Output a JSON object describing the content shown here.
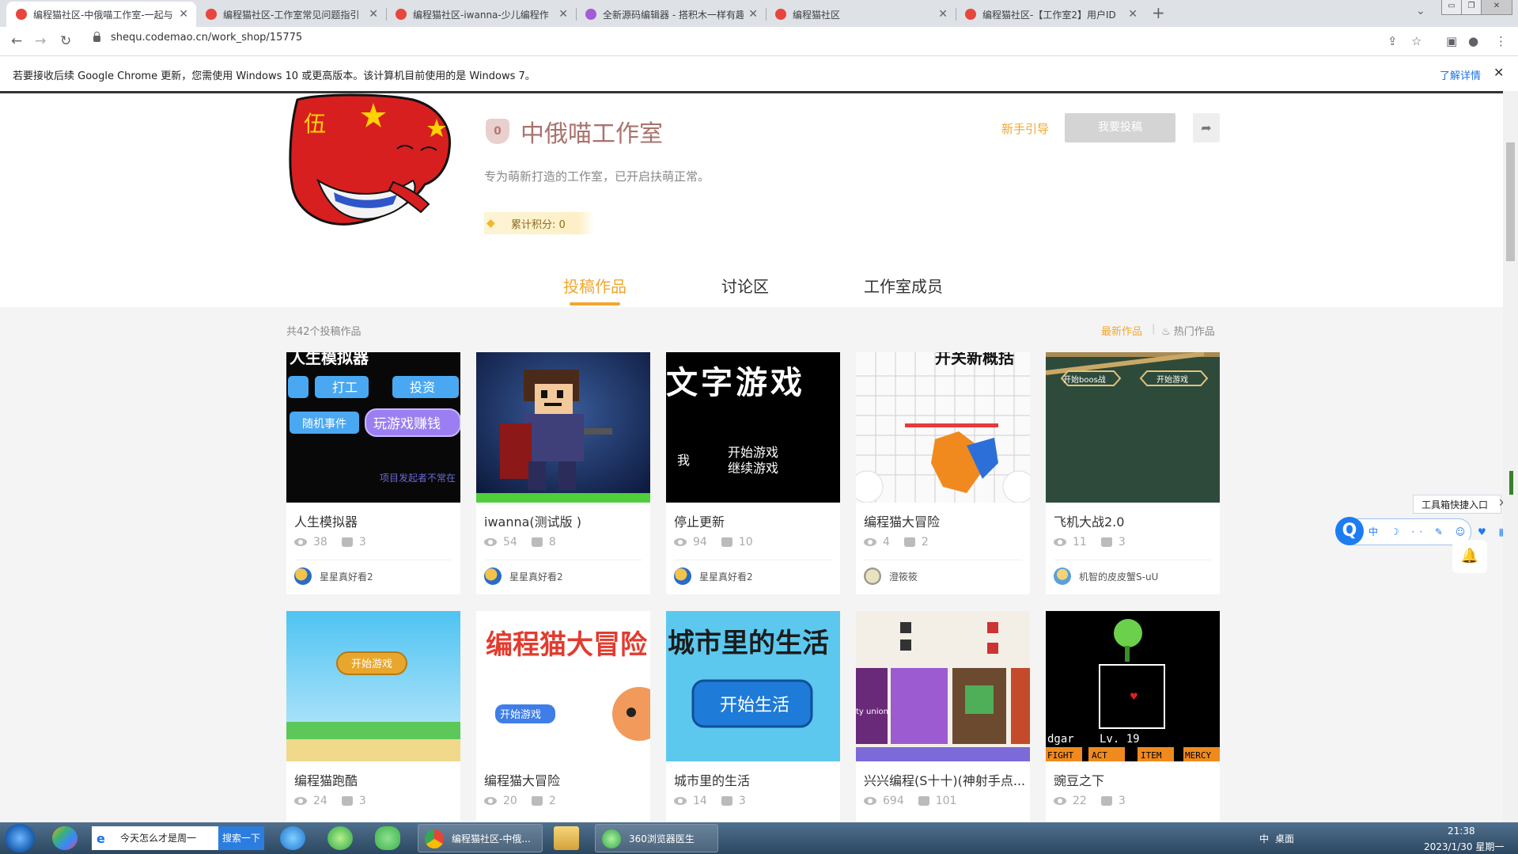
{
  "browser": {
    "tabs": [
      {
        "label": "编程猫社区-中俄喵工作室-一起与"
      },
      {
        "label": "编程猫社区-工作室常见问题指引"
      },
      {
        "label": "编程猫社区-iwanna-少儿编程作"
      },
      {
        "label": "全新源码编辑器 - 搭积木一样有趣"
      },
      {
        "label": "编程猫社区"
      },
      {
        "label": "编程猫社区-【工作室2】用户ID"
      }
    ],
    "url": "shequ.codemao.cn/work_shop/15775",
    "infobar": {
      "text": "若要接收后续 Google Chrome 更新，您需使用 Windows 10 或更高版本。该计算机目前使用的是 Windows 7。",
      "link": "了解详情"
    }
  },
  "studio": {
    "badge": "0",
    "title": "中俄喵工作室",
    "guide_link": "新手引导",
    "submit_button": "我要投稿",
    "description": "专为萌新打造的工作室，已开启扶萌正常。",
    "points": "累计积分: 0",
    "tabs": [
      "投稿作品",
      "讨论区",
      "工作室成员"
    ],
    "work_count": "共42个投稿作品",
    "sort": {
      "newest": "最新作品",
      "separator": "|",
      "hot": "热门作品"
    }
  },
  "works": [
    {
      "name": "人生模拟器",
      "views": "38",
      "likes": "3",
      "author": "星星真好看2",
      "thumb_text": [
        "人生模拟器",
        "打工",
        "投资",
        "随机事件",
        "玩游戏赚钱",
        "项目发起者不常在"
      ]
    },
    {
      "name": "iwanna(测试版 )",
      "views": "54",
      "likes": "8",
      "author": "星星真好看2"
    },
    {
      "name": "停止更新",
      "views": "94",
      "likes": "10",
      "author": "星星真好看2",
      "thumb_text": [
        "文字游戏",
        "我",
        "开始游戏",
        "继续游戏"
      ]
    },
    {
      "name": "编程猫大冒险",
      "views": "4",
      "likes": "2",
      "author": "澄筱筱",
      "thumb_text": [
        "开关新概括"
      ]
    },
    {
      "name": "飞机大战2.0",
      "views": "11",
      "likes": "3",
      "author": "机智的皮皮蟹S-uU",
      "thumb_text": [
        "开始boos战",
        "开始游戏"
      ]
    },
    {
      "name": "编程猫跑酷",
      "views": "24",
      "likes": "3",
      "thumb_text": [
        "开始游戏"
      ]
    },
    {
      "name": "编程猫大冒险",
      "views": "20",
      "likes": "2",
      "thumb_text": [
        "编程猫大冒险",
        "开始游戏"
      ]
    },
    {
      "name": "城市里的生活",
      "views": "14",
      "likes": "3",
      "thumb_text": [
        "城市里的生活",
        "开始生活"
      ]
    },
    {
      "name": "兴兴编程(S十十)(神射手点...",
      "views": "694",
      "likes": "101",
      "thumb_text": [
        "ty union"
      ]
    },
    {
      "name": "豌豆之下",
      "views": "22",
      "likes": "3",
      "thumb_text": [
        "dgar",
        "Lv. 19",
        "FIGHT",
        "ACT",
        "ITEM",
        "MERCY"
      ]
    }
  ],
  "side_tool": {
    "label": "工具箱快捷入口",
    "icons": "中 ☽ ·· ✎ ☺ ♥ ▦"
  },
  "taskbar": {
    "search_text": "今天怎么才是周一",
    "search_button": "搜索一下",
    "task_chrome": "编程猫社区-中俄...",
    "task_360": "360浏览器医生",
    "ime": "中",
    "desk": "桌面",
    "time": "21:38",
    "date": "2023/1/30 星期一"
  },
  "colors": {
    "accent": "#f1a72f",
    "title": "#a9736d",
    "link": "#1a73e8"
  }
}
